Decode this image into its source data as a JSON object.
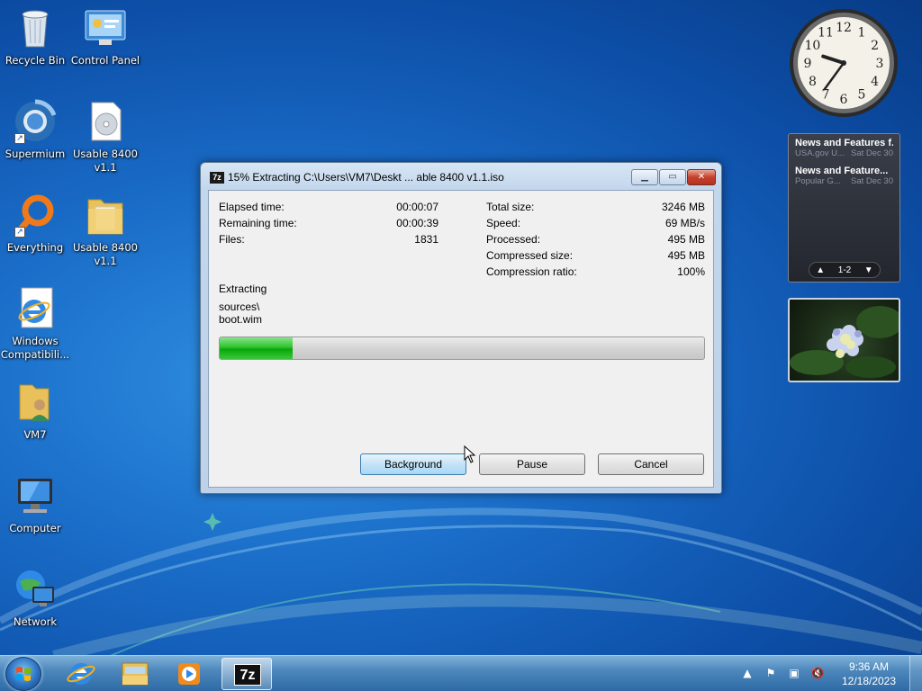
{
  "desktop": {
    "icons": [
      {
        "label": "Recycle Bin",
        "icon": "recycle-bin-icon"
      },
      {
        "label": "Control Panel",
        "icon": "control-panel-icon"
      },
      {
        "label": "Supermium",
        "icon": "supermium-browser-icon"
      },
      {
        "label": "Usable 8400\nv1.1",
        "icon": "disc-image-icon"
      },
      {
        "label": "Everything",
        "icon": "everything-search-icon"
      },
      {
        "label": "Usable 8400\nv1.1",
        "icon": "folder-icon"
      },
      {
        "label": "Windows\nCompatibili...",
        "icon": "internet-explorer-icon"
      },
      {
        "label": "VM7",
        "icon": "user-folder-icon"
      },
      {
        "label": "Computer",
        "icon": "computer-icon"
      },
      {
        "label": "Network",
        "icon": "network-icon"
      }
    ]
  },
  "clock_gadget": {
    "numerals": [
      "12",
      "1",
      "2",
      "3",
      "4",
      "5",
      "6",
      "7",
      "8",
      "9",
      "10",
      "11"
    ],
    "time_hour": 9,
    "time_minute": 36
  },
  "news_gadget": {
    "items": [
      {
        "title": "News and Features f...",
        "source": "USA.gov U...",
        "date": "Sat Dec 30"
      },
      {
        "title": "News and Feature...",
        "source": "Popular G...",
        "date": "Sat Dec 30"
      }
    ],
    "pager": "1-2"
  },
  "dialog": {
    "app_badge": "7z",
    "title": "15% Extracting C:\\Users\\VM7\\Deskt ... able 8400 v1.1.iso",
    "left_stats": [
      {
        "label": "Elapsed time:",
        "value": "00:00:07"
      },
      {
        "label": "Remaining time:",
        "value": "00:00:39"
      },
      {
        "label": "Files:",
        "value": "1831"
      }
    ],
    "right_stats": [
      {
        "label": "Total size:",
        "value": "3246 MB"
      },
      {
        "label": "Speed:",
        "value": "69 MB/s"
      },
      {
        "label": "Processed:",
        "value": "495 MB"
      },
      {
        "label": "Compressed size:",
        "value": "495 MB"
      },
      {
        "label": "Compression ratio:",
        "value": "100%"
      }
    ],
    "status_label": "Extracting",
    "current_path": "sources\\",
    "current_file": "boot.wim",
    "progress_percent": 15,
    "buttons": {
      "background": "Background",
      "pause": "Pause",
      "cancel": "Cancel"
    }
  },
  "taskbar": {
    "pinned": [
      "internet-explorer-icon",
      "windows-explorer-icon",
      "media-player-icon",
      "7zip-icon"
    ],
    "active_app_badge": "7z",
    "time": "9:36 AM",
    "date": "12/18/2023"
  }
}
